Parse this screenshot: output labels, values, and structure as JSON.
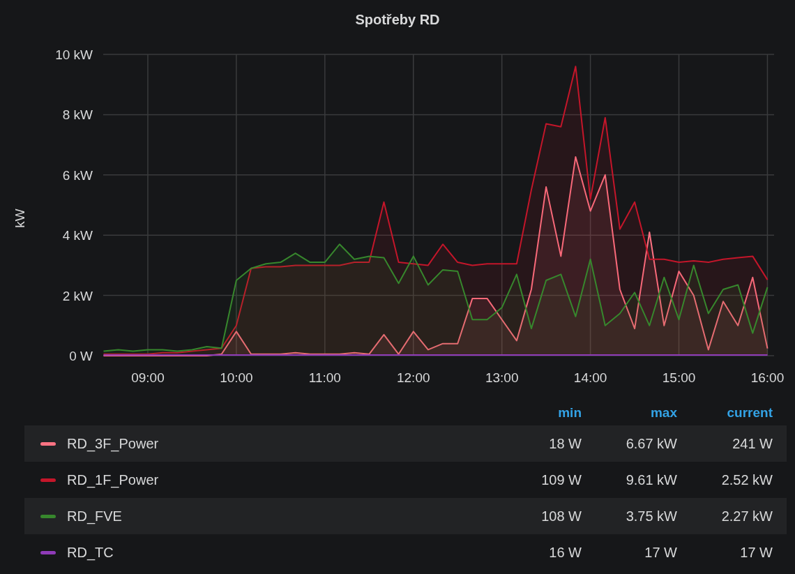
{
  "panel": {
    "title": "Spotřeby RD"
  },
  "chart": {
    "chart_data": {
      "type": "area",
      "ylabel": "kW",
      "grid": true,
      "x": [
        8.5,
        8.667,
        8.833,
        9.0,
        9.167,
        9.333,
        9.5,
        9.667,
        9.833,
        10.0,
        10.167,
        10.333,
        10.5,
        10.667,
        10.833,
        11.0,
        11.167,
        11.333,
        11.5,
        11.667,
        11.833,
        12.0,
        12.167,
        12.333,
        12.5,
        12.667,
        12.833,
        13.0,
        13.167,
        13.333,
        13.5,
        13.667,
        13.833,
        14.0,
        14.167,
        14.333,
        14.5,
        14.667,
        14.833,
        15.0,
        15.167,
        15.333,
        15.5,
        15.667,
        15.833,
        16.0
      ],
      "xlim": [
        8.496,
        16.02
      ],
      "ylim": [
        0,
        10
      ],
      "xticks": [
        {
          "value": 9,
          "label": "09:00"
        },
        {
          "value": 10,
          "label": "10:00"
        },
        {
          "value": 11,
          "label": "11:00"
        },
        {
          "value": 12,
          "label": "12:00"
        },
        {
          "value": 13,
          "label": "13:00"
        },
        {
          "value": 14,
          "label": "14:00"
        },
        {
          "value": 15,
          "label": "15:00"
        },
        {
          "value": 16,
          "label": "16:00"
        }
      ],
      "yticks": [
        {
          "value": 0,
          "label": "0 W"
        },
        {
          "value": 2,
          "label": "2 kW"
        },
        {
          "value": 4,
          "label": "4 kW"
        },
        {
          "value": 6,
          "label": "6 kW"
        },
        {
          "value": 8,
          "label": "8 kW"
        },
        {
          "value": 10,
          "label": "10 kW"
        }
      ],
      "series": [
        {
          "name": "RD_3F_Power",
          "color": "#ff7383",
          "values": [
            0,
            0,
            0,
            0,
            0,
            0,
            0,
            0,
            0.05,
            0.8,
            0.05,
            0.05,
            0.05,
            0.1,
            0.05,
            0.05,
            0.05,
            0.1,
            0.05,
            0.7,
            0.05,
            0.8,
            0.2,
            0.4,
            0.4,
            1.9,
            1.9,
            1.2,
            0.5,
            2.2,
            5.6,
            3.3,
            6.6,
            4.8,
            6.0,
            2.2,
            0.9,
            4.1,
            1.0,
            2.8,
            2.0,
            0.2,
            1.8,
            1.0,
            2.6,
            0.24
          ]
        },
        {
          "name": "RD_1F_Power",
          "color": "#c4162a",
          "values": [
            0.05,
            0.05,
            0.05,
            0.05,
            0.1,
            0.1,
            0.15,
            0.2,
            0.25,
            1.0,
            2.9,
            2.95,
            2.95,
            3.0,
            3.0,
            3.0,
            3.0,
            3.1,
            3.1,
            5.1,
            3.1,
            3.05,
            3.0,
            3.7,
            3.1,
            3.0,
            3.05,
            3.05,
            3.05,
            5.5,
            7.7,
            7.6,
            9.6,
            5.2,
            7.9,
            4.2,
            5.1,
            3.2,
            3.2,
            3.1,
            3.15,
            3.1,
            3.2,
            3.25,
            3.3,
            2.52
          ]
        },
        {
          "name": "RD_FVE",
          "color": "#37872d",
          "values": [
            0.15,
            0.2,
            0.15,
            0.2,
            0.2,
            0.15,
            0.2,
            0.3,
            0.25,
            2.5,
            2.9,
            3.05,
            3.1,
            3.4,
            3.1,
            3.1,
            3.7,
            3.2,
            3.3,
            3.25,
            2.4,
            3.3,
            2.35,
            2.85,
            2.8,
            1.2,
            1.2,
            1.6,
            2.7,
            0.9,
            2.5,
            2.7,
            1.3,
            3.2,
            1.0,
            1.4,
            2.1,
            1.0,
            2.6,
            1.2,
            3.0,
            1.4,
            2.2,
            2.35,
            0.75,
            2.27
          ]
        },
        {
          "name": "RD_TC",
          "color": "#8f3bb8",
          "values": [
            0.02,
            0.02,
            0.02,
            0.02,
            0.02,
            0.02,
            0.02,
            0.02,
            0.02,
            0.02,
            0.02,
            0.02,
            0.02,
            0.02,
            0.02,
            0.02,
            0.02,
            0.02,
            0.02,
            0.02,
            0.02,
            0.02,
            0.02,
            0.02,
            0.02,
            0.02,
            0.02,
            0.02,
            0.02,
            0.02,
            0.02,
            0.02,
            0.02,
            0.02,
            0.02,
            0.02,
            0.02,
            0.02,
            0.02,
            0.02,
            0.02,
            0.02,
            0.02,
            0.02,
            0.02,
            0.02
          ]
        }
      ]
    }
  },
  "legend": {
    "columns": [
      "min",
      "max",
      "current"
    ],
    "rows": [
      {
        "min": "18 W",
        "max": "6.67 kW",
        "current": "241 W"
      },
      {
        "min": "109 W",
        "max": "9.61 kW",
        "current": "2.52 kW"
      },
      {
        "min": "108 W",
        "max": "3.75 kW",
        "current": "2.27 kW"
      },
      {
        "min": "16 W",
        "max": "17 W",
        "current": "17 W"
      }
    ]
  }
}
